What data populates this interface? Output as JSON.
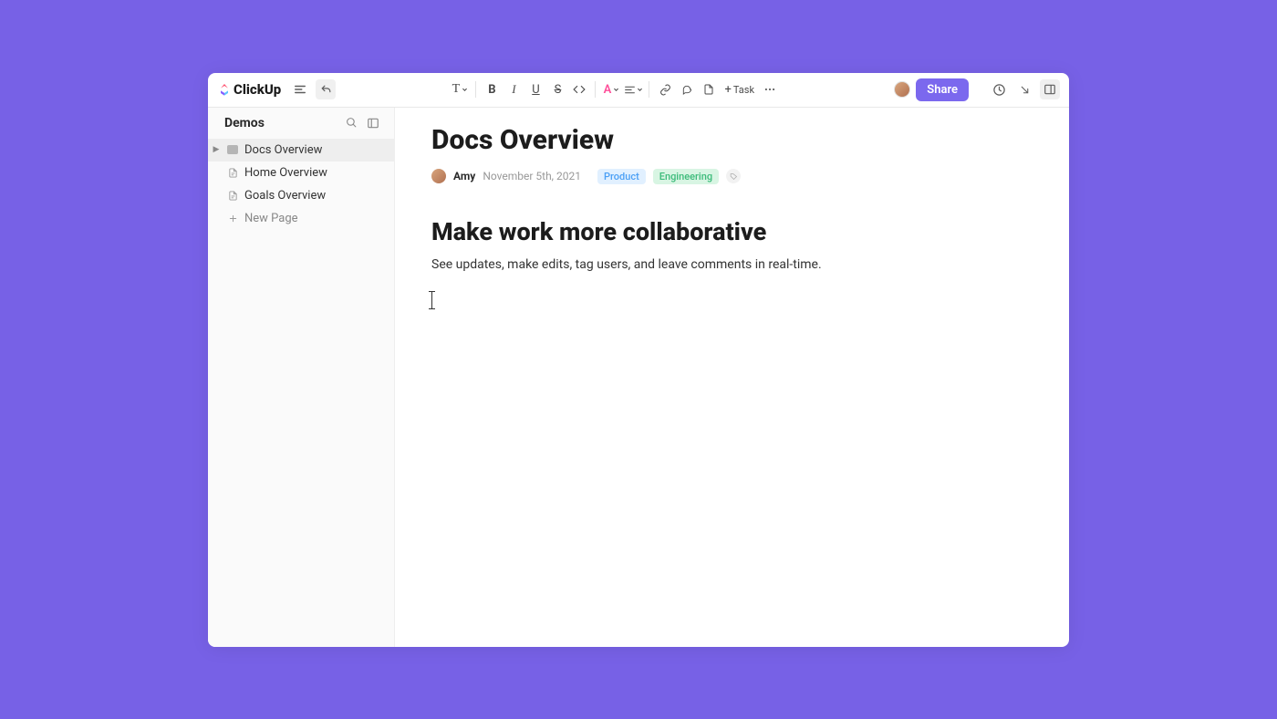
{
  "brand": "ClickUp",
  "sidebar": {
    "title": "Demos",
    "items": [
      {
        "label": "Docs Overview",
        "active": true,
        "iconType": "filled"
      },
      {
        "label": "Home Overview",
        "active": false,
        "iconType": "doc"
      },
      {
        "label": "Goals Overview",
        "active": false,
        "iconType": "doc"
      }
    ],
    "newPageLabel": "New Page"
  },
  "toolbar": {
    "taskLabel": "Task",
    "shareLabel": "Share"
  },
  "document": {
    "title": "Docs Overview",
    "author": "Amy",
    "date": "November 5th, 2021",
    "tags": [
      {
        "text": "Product",
        "class": "tag-product"
      },
      {
        "text": "Engineering",
        "class": "tag-engineering"
      }
    ],
    "heading": "Make work more collaborative",
    "body": "See updates, make edits, tag users, and leave comments in real-time."
  }
}
